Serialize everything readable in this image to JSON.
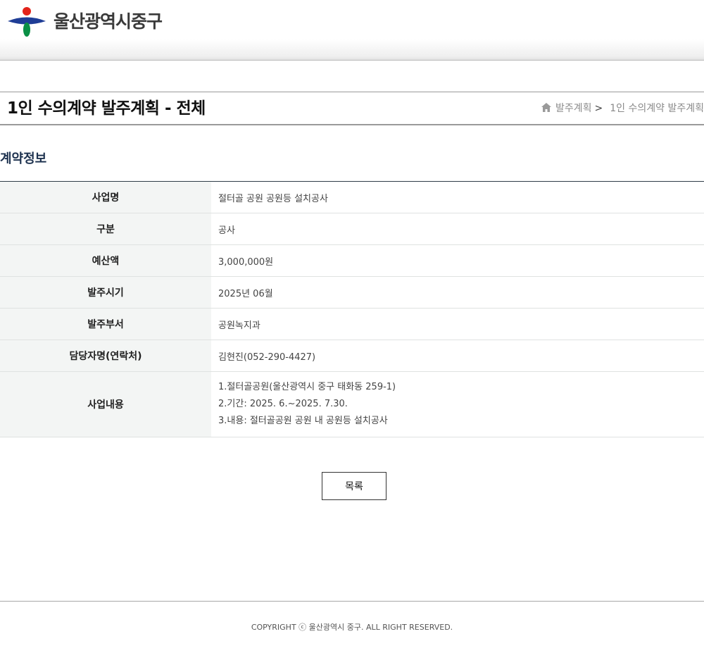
{
  "header": {
    "org_name": "울산광역시중구",
    "colors": {
      "logo_red": "#e2231a",
      "logo_blue": "#1f3d96",
      "logo_green": "#0a8f45"
    }
  },
  "title_bar": {
    "title": "1인 수의계약 발주계획 - 전체",
    "breadcrumb": {
      "home_icon": "home-icon",
      "item1": "발주계획",
      "separator": ">",
      "item2": "1인 수의계약 발주계획"
    }
  },
  "section": {
    "title": "계약정보"
  },
  "contract": {
    "rows": [
      {
        "label": "사업명",
        "value": "절터골 공원 공원등 설치공사"
      },
      {
        "label": "구분",
        "value": "공사"
      },
      {
        "label": "예산액",
        "value": "3,000,000원"
      },
      {
        "label": "발주시기",
        "value": "2025년 06월"
      },
      {
        "label": "발주부서",
        "value": "공원녹지과"
      },
      {
        "label": "담당자명(연락처)",
        "value": "김현진(052-290-4427)"
      }
    ],
    "details": {
      "label": "사업내용",
      "lines": [
        "1.절터골공원(울산광역시 중구 태화동 259-1)",
        "2.기간: 2025. 6.~2025. 7.30.",
        "3.내용: 절터골공원 공원 내 공원등 설치공사"
      ]
    }
  },
  "actions": {
    "list_label": "목록"
  },
  "footer": {
    "copyright": "COPYRIGHT ⓒ 울산광역시 중구. ALL RIGHT RESERVED."
  }
}
